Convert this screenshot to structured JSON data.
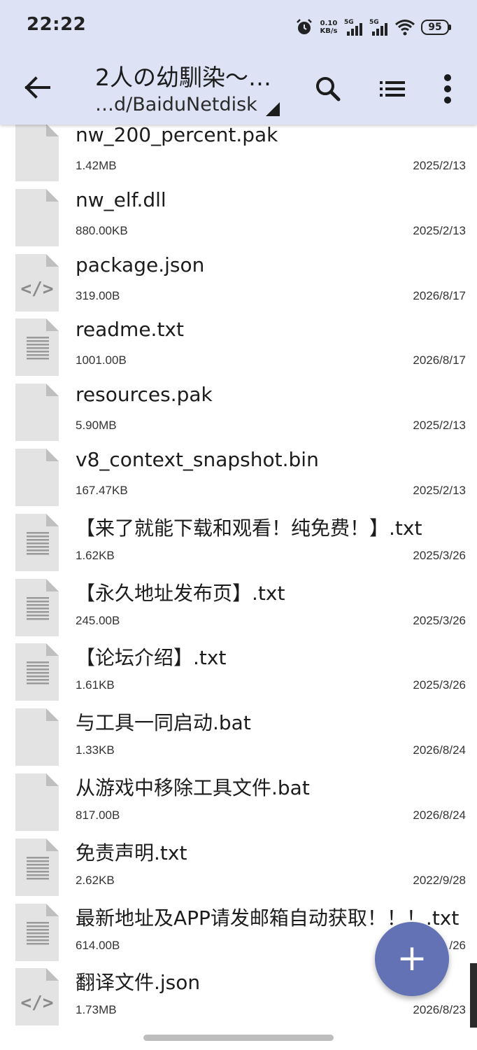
{
  "status_bar": {
    "time": "22:22",
    "net_speed_value": "0.10",
    "net_speed_unit": "KB/s",
    "signal1_label": "5G",
    "signal2_label": "5G",
    "battery": "95"
  },
  "toolbar": {
    "title": "2人の幼馴染～…",
    "path": "…d/BaiduNetdisk"
  },
  "files": [
    {
      "name": "nw_200_percent.pak",
      "size": "1.42MB",
      "date": "2025/2/13",
      "icon": "file-generic-icon"
    },
    {
      "name": "nw_elf.dll",
      "size": "880.00KB",
      "date": "2025/2/13",
      "icon": "file-generic-icon"
    },
    {
      "name": "package.json",
      "size": "319.00B",
      "date": "2026/8/17",
      "icon": "file-code-icon"
    },
    {
      "name": "readme.txt",
      "size": "1001.00B",
      "date": "2026/8/17",
      "icon": "file-text-icon"
    },
    {
      "name": "resources.pak",
      "size": "5.90MB",
      "date": "2025/2/13",
      "icon": "file-generic-icon"
    },
    {
      "name": "v8_context_snapshot.bin",
      "size": "167.47KB",
      "date": "2025/2/13",
      "icon": "file-generic-icon"
    },
    {
      "name": "【来了就能下载和观看！纯免费！】.txt",
      "size": "1.62KB",
      "date": "2025/3/26",
      "icon": "file-text-icon"
    },
    {
      "name": "【永久地址发布页】.txt",
      "size": "245.00B",
      "date": "2025/3/26",
      "icon": "file-text-icon"
    },
    {
      "name": "【论坛介绍】.txt",
      "size": "1.61KB",
      "date": "2025/3/26",
      "icon": "file-text-icon"
    },
    {
      "name": "与工具一同启动.bat",
      "size": "1.33KB",
      "date": "2026/8/24",
      "icon": "file-generic-icon"
    },
    {
      "name": "从游戏中移除工具文件.bat",
      "size": "817.00B",
      "date": "2026/8/24",
      "icon": "file-generic-icon"
    },
    {
      "name": "免责声明.txt",
      "size": "2.62KB",
      "date": "2022/9/28",
      "icon": "file-text-icon"
    },
    {
      "name": "最新地址及APP请发邮箱自动获取！！！.txt",
      "size": "614.00B",
      "date": "/26",
      "icon": "file-text-icon"
    },
    {
      "name": "翻译文件.json",
      "size": "1.73MB",
      "date": "2026/8/23",
      "icon": "file-code-icon"
    }
  ],
  "fab": {
    "label": "+",
    "icon": "plus-icon"
  },
  "colors": {
    "header_bg": "#dde2f4",
    "fab_bg": "#6272b4",
    "icon_bg": "#e3e3e3",
    "icon_fold": "#bfbfbf"
  }
}
